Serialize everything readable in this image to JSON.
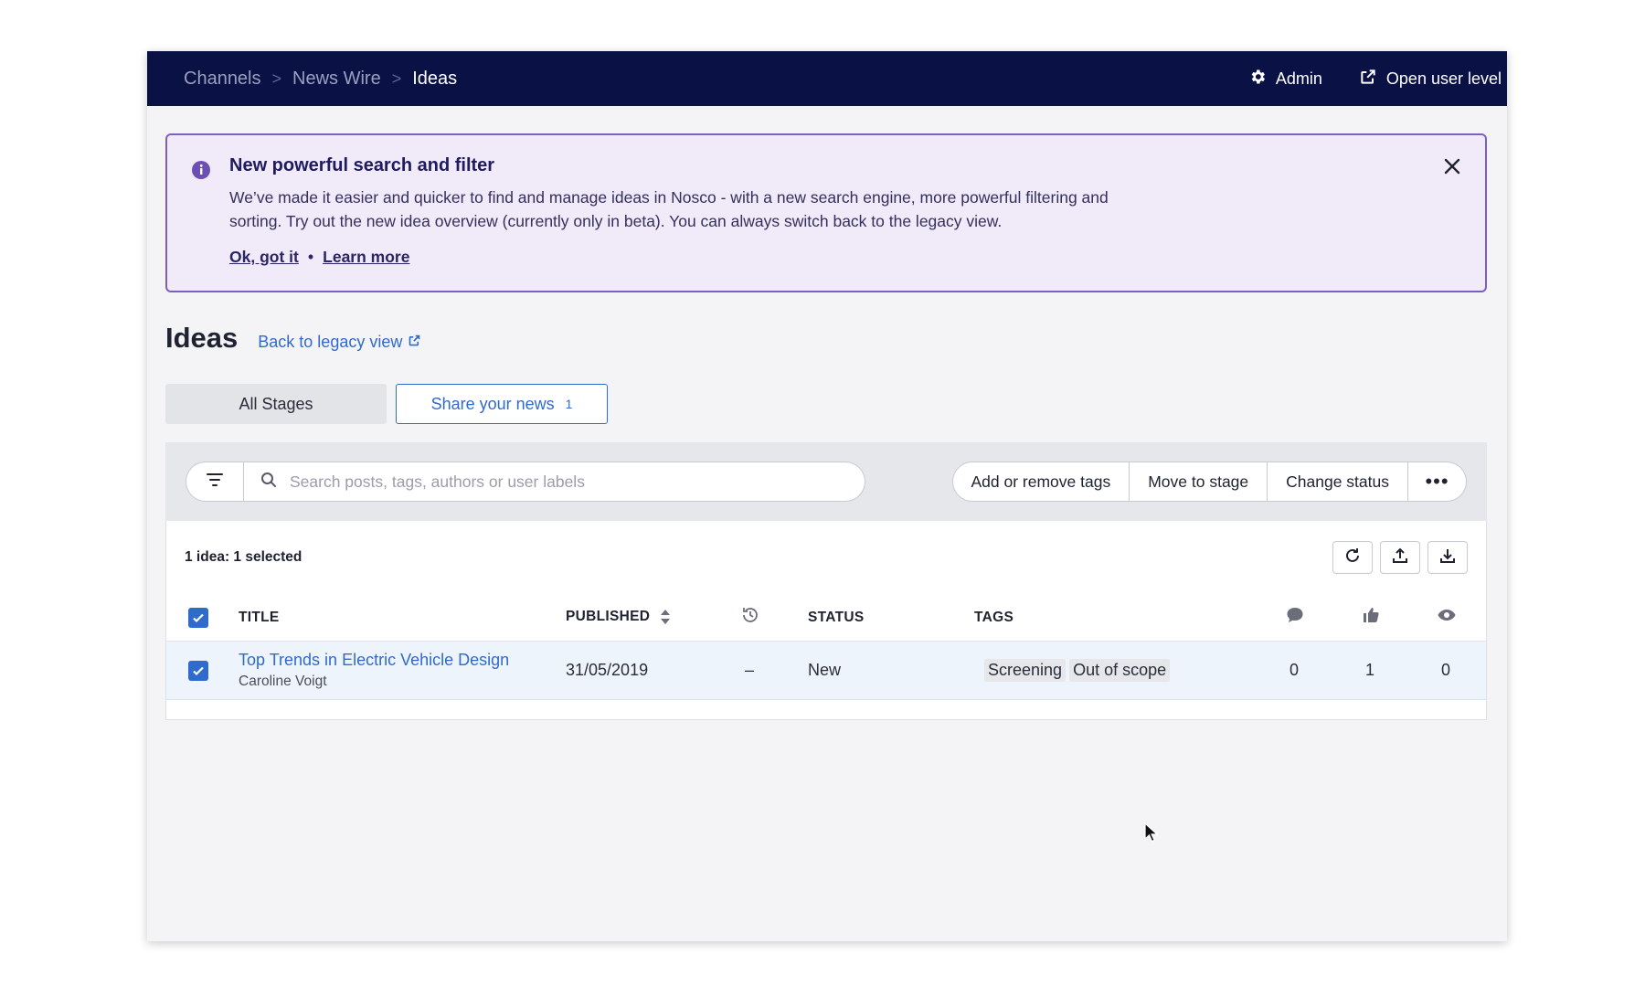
{
  "header": {
    "breadcrumb": [
      "Channels",
      "News Wire",
      "Ideas"
    ],
    "breadcrumb_separator": ">",
    "admin_label": "Admin",
    "open_user_level_label": "Open user level"
  },
  "banner": {
    "title": "New powerful search and filter",
    "text": "We’ve made it easier and quicker to find and manage ideas in Nosco - with a new search engine, more powerful filtering and sorting. Try out the new idea overview (currently only in beta). You can always switch back to the legacy view.",
    "ok_label": "Ok, got it",
    "bullet": "•",
    "learn_more_label": "Learn more"
  },
  "page": {
    "title": "Ideas",
    "legacy_link": "Back to legacy view"
  },
  "stages": [
    {
      "label": "All Stages"
    },
    {
      "label": "Share your news",
      "count": "1"
    }
  ],
  "toolbar": {
    "search_placeholder": "Search posts, tags, authors or user labels",
    "actions": [
      "Add or remove tags",
      "Move to stage",
      "Change status"
    ],
    "more_label": "•••"
  },
  "list": {
    "selection_summary": "1 idea: 1 selected",
    "columns": {
      "title": "TITLE",
      "published": "PUBLISHED",
      "status": "STATUS",
      "tags": "TAGS"
    },
    "rows": [
      {
        "title": "Top Trends in Electric Vehicle Design",
        "author": "Caroline Voigt",
        "published": "31/05/2019",
        "updated": "–",
        "status": "New",
        "tags": [
          "Screening",
          "Out of scope"
        ],
        "comments": "0",
        "likes": "1",
        "views": "0"
      }
    ]
  },
  "colors": {
    "topbar": "#0a1145",
    "accent": "#2f6bcb",
    "banner_border": "#7d5fc1",
    "banner_bg": "#f1eaf8"
  },
  "icons": [
    "gear-icon",
    "external-link-icon",
    "info-icon",
    "close-icon",
    "filter-icon",
    "search-icon",
    "refresh-icon",
    "upload-icon",
    "download-icon",
    "sort-icon",
    "history-icon",
    "comment-icon",
    "thumbs-up-icon",
    "eye-icon",
    "checkmark-icon",
    "mouse-cursor-icon"
  ]
}
